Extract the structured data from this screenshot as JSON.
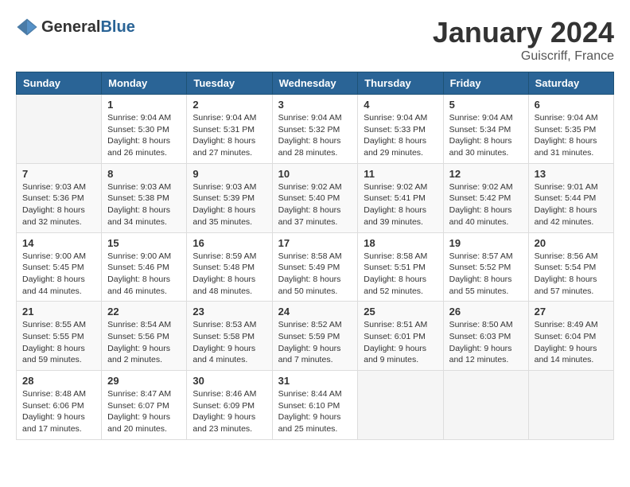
{
  "header": {
    "logo_general": "General",
    "logo_blue": "Blue",
    "month_year": "January 2024",
    "location": "Guiscriff, France"
  },
  "weekdays": [
    "Sunday",
    "Monday",
    "Tuesday",
    "Wednesday",
    "Thursday",
    "Friday",
    "Saturday"
  ],
  "weeks": [
    [
      {
        "day": "",
        "sunrise": "",
        "sunset": "",
        "daylight": ""
      },
      {
        "day": "1",
        "sunrise": "Sunrise: 9:04 AM",
        "sunset": "Sunset: 5:30 PM",
        "daylight": "Daylight: 8 hours and 26 minutes."
      },
      {
        "day": "2",
        "sunrise": "Sunrise: 9:04 AM",
        "sunset": "Sunset: 5:31 PM",
        "daylight": "Daylight: 8 hours and 27 minutes."
      },
      {
        "day": "3",
        "sunrise": "Sunrise: 9:04 AM",
        "sunset": "Sunset: 5:32 PM",
        "daylight": "Daylight: 8 hours and 28 minutes."
      },
      {
        "day": "4",
        "sunrise": "Sunrise: 9:04 AM",
        "sunset": "Sunset: 5:33 PM",
        "daylight": "Daylight: 8 hours and 29 minutes."
      },
      {
        "day": "5",
        "sunrise": "Sunrise: 9:04 AM",
        "sunset": "Sunset: 5:34 PM",
        "daylight": "Daylight: 8 hours and 30 minutes."
      },
      {
        "day": "6",
        "sunrise": "Sunrise: 9:04 AM",
        "sunset": "Sunset: 5:35 PM",
        "daylight": "Daylight: 8 hours and 31 minutes."
      }
    ],
    [
      {
        "day": "7",
        "sunrise": "Sunrise: 9:03 AM",
        "sunset": "Sunset: 5:36 PM",
        "daylight": "Daylight: 8 hours and 32 minutes."
      },
      {
        "day": "8",
        "sunrise": "Sunrise: 9:03 AM",
        "sunset": "Sunset: 5:38 PM",
        "daylight": "Daylight: 8 hours and 34 minutes."
      },
      {
        "day": "9",
        "sunrise": "Sunrise: 9:03 AM",
        "sunset": "Sunset: 5:39 PM",
        "daylight": "Daylight: 8 hours and 35 minutes."
      },
      {
        "day": "10",
        "sunrise": "Sunrise: 9:02 AM",
        "sunset": "Sunset: 5:40 PM",
        "daylight": "Daylight: 8 hours and 37 minutes."
      },
      {
        "day": "11",
        "sunrise": "Sunrise: 9:02 AM",
        "sunset": "Sunset: 5:41 PM",
        "daylight": "Daylight: 8 hours and 39 minutes."
      },
      {
        "day": "12",
        "sunrise": "Sunrise: 9:02 AM",
        "sunset": "Sunset: 5:42 PM",
        "daylight": "Daylight: 8 hours and 40 minutes."
      },
      {
        "day": "13",
        "sunrise": "Sunrise: 9:01 AM",
        "sunset": "Sunset: 5:44 PM",
        "daylight": "Daylight: 8 hours and 42 minutes."
      }
    ],
    [
      {
        "day": "14",
        "sunrise": "Sunrise: 9:00 AM",
        "sunset": "Sunset: 5:45 PM",
        "daylight": "Daylight: 8 hours and 44 minutes."
      },
      {
        "day": "15",
        "sunrise": "Sunrise: 9:00 AM",
        "sunset": "Sunset: 5:46 PM",
        "daylight": "Daylight: 8 hours and 46 minutes."
      },
      {
        "day": "16",
        "sunrise": "Sunrise: 8:59 AM",
        "sunset": "Sunset: 5:48 PM",
        "daylight": "Daylight: 8 hours and 48 minutes."
      },
      {
        "day": "17",
        "sunrise": "Sunrise: 8:58 AM",
        "sunset": "Sunset: 5:49 PM",
        "daylight": "Daylight: 8 hours and 50 minutes."
      },
      {
        "day": "18",
        "sunrise": "Sunrise: 8:58 AM",
        "sunset": "Sunset: 5:51 PM",
        "daylight": "Daylight: 8 hours and 52 minutes."
      },
      {
        "day": "19",
        "sunrise": "Sunrise: 8:57 AM",
        "sunset": "Sunset: 5:52 PM",
        "daylight": "Daylight: 8 hours and 55 minutes."
      },
      {
        "day": "20",
        "sunrise": "Sunrise: 8:56 AM",
        "sunset": "Sunset: 5:54 PM",
        "daylight": "Daylight: 8 hours and 57 minutes."
      }
    ],
    [
      {
        "day": "21",
        "sunrise": "Sunrise: 8:55 AM",
        "sunset": "Sunset: 5:55 PM",
        "daylight": "Daylight: 8 hours and 59 minutes."
      },
      {
        "day": "22",
        "sunrise": "Sunrise: 8:54 AM",
        "sunset": "Sunset: 5:56 PM",
        "daylight": "Daylight: 9 hours and 2 minutes."
      },
      {
        "day": "23",
        "sunrise": "Sunrise: 8:53 AM",
        "sunset": "Sunset: 5:58 PM",
        "daylight": "Daylight: 9 hours and 4 minutes."
      },
      {
        "day": "24",
        "sunrise": "Sunrise: 8:52 AM",
        "sunset": "Sunset: 5:59 PM",
        "daylight": "Daylight: 9 hours and 7 minutes."
      },
      {
        "day": "25",
        "sunrise": "Sunrise: 8:51 AM",
        "sunset": "Sunset: 6:01 PM",
        "daylight": "Daylight: 9 hours and 9 minutes."
      },
      {
        "day": "26",
        "sunrise": "Sunrise: 8:50 AM",
        "sunset": "Sunset: 6:03 PM",
        "daylight": "Daylight: 9 hours and 12 minutes."
      },
      {
        "day": "27",
        "sunrise": "Sunrise: 8:49 AM",
        "sunset": "Sunset: 6:04 PM",
        "daylight": "Daylight: 9 hours and 14 minutes."
      }
    ],
    [
      {
        "day": "28",
        "sunrise": "Sunrise: 8:48 AM",
        "sunset": "Sunset: 6:06 PM",
        "daylight": "Daylight: 9 hours and 17 minutes."
      },
      {
        "day": "29",
        "sunrise": "Sunrise: 8:47 AM",
        "sunset": "Sunset: 6:07 PM",
        "daylight": "Daylight: 9 hours and 20 minutes."
      },
      {
        "day": "30",
        "sunrise": "Sunrise: 8:46 AM",
        "sunset": "Sunset: 6:09 PM",
        "daylight": "Daylight: 9 hours and 23 minutes."
      },
      {
        "day": "31",
        "sunrise": "Sunrise: 8:44 AM",
        "sunset": "Sunset: 6:10 PM",
        "daylight": "Daylight: 9 hours and 25 minutes."
      },
      {
        "day": "",
        "sunrise": "",
        "sunset": "",
        "daylight": ""
      },
      {
        "day": "",
        "sunrise": "",
        "sunset": "",
        "daylight": ""
      },
      {
        "day": "",
        "sunrise": "",
        "sunset": "",
        "daylight": ""
      }
    ]
  ]
}
